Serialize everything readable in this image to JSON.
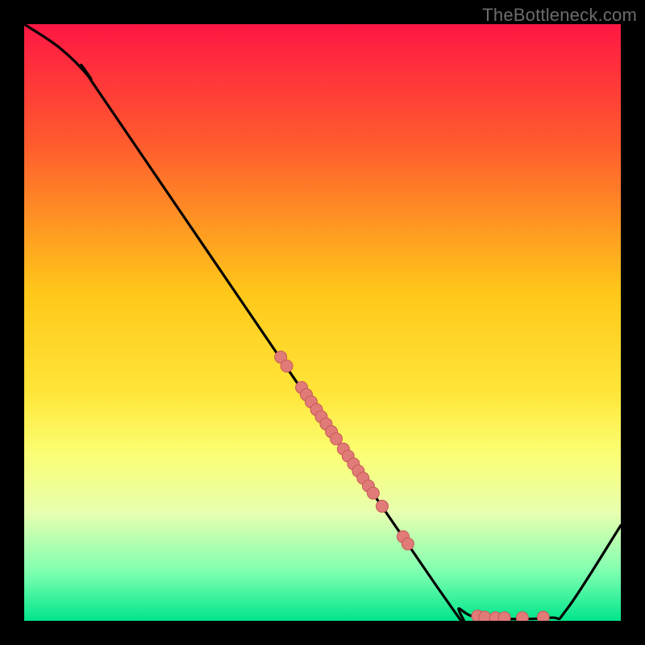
{
  "watermark": "TheBottleneck.com",
  "colors": {
    "curve": "#000000",
    "point_fill": "#e07b78",
    "point_stroke": "#c75a57",
    "frame": "#000000"
  },
  "chart_data": {
    "type": "line",
    "title": "",
    "xlabel": "",
    "ylabel": "",
    "xlim": [
      0,
      100
    ],
    "ylim": [
      0,
      100
    ],
    "gradient_stops": [
      {
        "offset": 0,
        "color": "#ff1744"
      },
      {
        "offset": 20,
        "color": "#ff5b2e"
      },
      {
        "offset": 45,
        "color": "#ffc819"
      },
      {
        "offset": 62,
        "color": "#ffe63a"
      },
      {
        "offset": 72,
        "color": "#fbff74"
      },
      {
        "offset": 82,
        "color": "#e7ffb0"
      },
      {
        "offset": 92,
        "color": "#7cffb0"
      },
      {
        "offset": 100,
        "color": "#00e58b"
      }
    ],
    "curve": [
      {
        "x": 0,
        "y": 100
      },
      {
        "x": 6,
        "y": 96
      },
      {
        "x": 11,
        "y": 91
      },
      {
        "x": 15,
        "y": 85
      },
      {
        "x": 69,
        "y": 6
      },
      {
        "x": 73,
        "y": 2
      },
      {
        "x": 77,
        "y": 0.5
      },
      {
        "x": 88,
        "y": 0.5
      },
      {
        "x": 91,
        "y": 2
      },
      {
        "x": 100,
        "y": 16
      }
    ],
    "points": [
      {
        "x": 43,
        "y": 44.2
      },
      {
        "x": 44,
        "y": 42.7
      },
      {
        "x": 46.5,
        "y": 39.1
      },
      {
        "x": 47.3,
        "y": 37.9
      },
      {
        "x": 48.1,
        "y": 36.7
      },
      {
        "x": 49.0,
        "y": 35.4
      },
      {
        "x": 49.8,
        "y": 34.2
      },
      {
        "x": 50.6,
        "y": 33.0
      },
      {
        "x": 51.5,
        "y": 31.7
      },
      {
        "x": 52.3,
        "y": 30.5
      },
      {
        "x": 53.5,
        "y": 28.8
      },
      {
        "x": 54.3,
        "y": 27.6
      },
      {
        "x": 55.2,
        "y": 26.3
      },
      {
        "x": 56.0,
        "y": 25.1
      },
      {
        "x": 56.8,
        "y": 23.9
      },
      {
        "x": 57.7,
        "y": 22.6
      },
      {
        "x": 58.5,
        "y": 21.4
      },
      {
        "x": 60.0,
        "y": 19.2
      },
      {
        "x": 63.5,
        "y": 14.1
      },
      {
        "x": 64.3,
        "y": 12.9
      },
      {
        "x": 76.0,
        "y": 0.8
      },
      {
        "x": 77.2,
        "y": 0.6
      },
      {
        "x": 79.0,
        "y": 0.5
      },
      {
        "x": 80.5,
        "y": 0.5
      },
      {
        "x": 83.5,
        "y": 0.5
      },
      {
        "x": 87.0,
        "y": 0.6
      }
    ]
  }
}
